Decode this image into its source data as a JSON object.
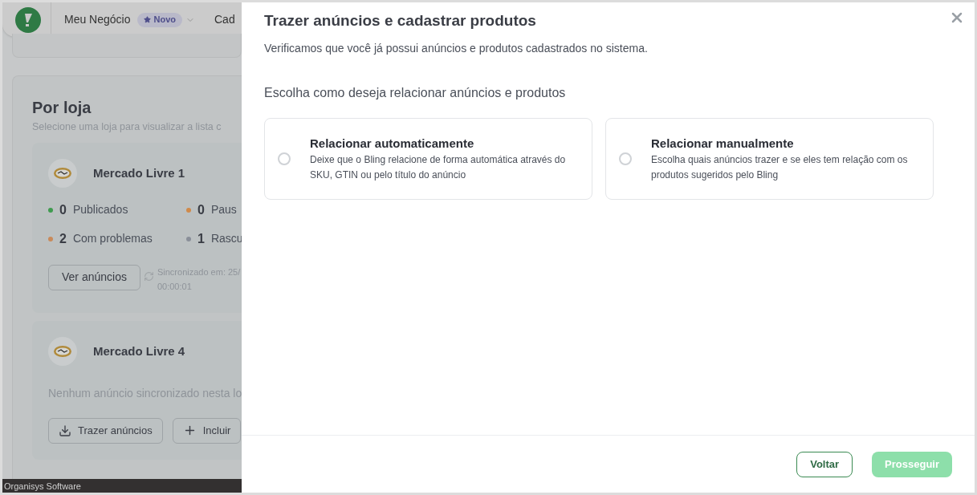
{
  "header": {
    "menu_item": "Meu Negócio",
    "badge": "Novo",
    "next_menu": "Cad"
  },
  "section": {
    "title": "Por loja",
    "subtitle": "Selecione uma loja para visualizar a lista c"
  },
  "stores": [
    {
      "kind": "stats",
      "name": "Mercado Livre 1",
      "stats": [
        {
          "count": "0",
          "label": "Publicados",
          "color": "#3f9b4f"
        },
        {
          "count": "0",
          "label": "Paus",
          "color": "#d08a4a"
        },
        {
          "count": "2",
          "label": "Com problemas",
          "color": "#c98a5a"
        },
        {
          "count": "1",
          "label": "Rascu",
          "color": "#8a8f99"
        }
      ],
      "button": "Ver anúncios",
      "sync": [
        "Sincronizado em: 25/",
        "00:00:01"
      ]
    },
    {
      "kind": "empty",
      "name": "Mercado Livre 4",
      "message": "Nenhum anúncio sincronizado nesta lo",
      "buttons": [
        {
          "kind": "download",
          "label": "Trazer anúncios"
        },
        {
          "kind": "add",
          "label": "Incluir"
        }
      ]
    }
  ],
  "footer": "Organisys Software",
  "modal": {
    "title": "Trazer anúncios e cadastrar produtos",
    "description": "Verificamos que você já possui anúncios e produtos cadastrados no sistema.",
    "question": "Escolha como deseja relacionar anúncios e produtos",
    "options": [
      {
        "title": "Relacionar automaticamente",
        "description": "Deixe que o Bling relacione de forma automática através do SKU, GTIN ou pelo título do anúncio",
        "selected": false
      },
      {
        "title": "Relacionar manualmente",
        "description": "Escolha quais anúncios trazer e se eles tem relação com os produtos sugeridos pelo Bling",
        "selected": false
      }
    ],
    "back": "Voltar",
    "next": {
      "label": "Prosseguir",
      "disabled": true
    }
  }
}
